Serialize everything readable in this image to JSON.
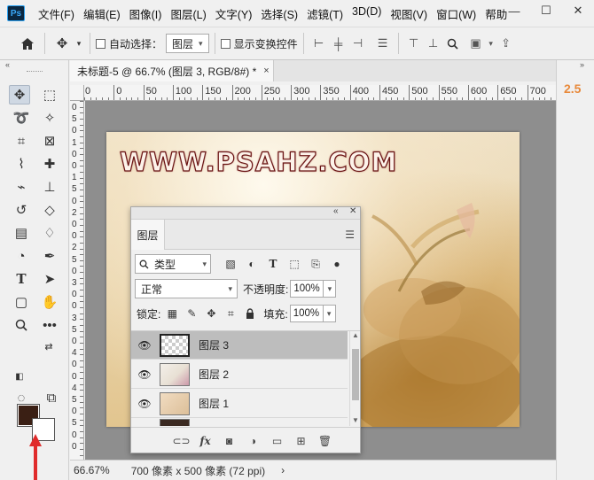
{
  "app": {
    "logo_text": "Ps"
  },
  "menu": [
    "文件(F)",
    "编辑(E)",
    "图像(I)",
    "图层(L)",
    "文字(Y)",
    "选择(S)",
    "滤镜(T)",
    "3D(D)",
    "视图(V)",
    "窗口(W)",
    "帮助"
  ],
  "window_controls": {
    "minimize": "—",
    "restore": "☐",
    "close": "✕"
  },
  "options": {
    "auto_select_label": "自动选择：",
    "auto_select_target": "图层",
    "show_transform_label": "显示变换控件"
  },
  "document": {
    "tab_title": "未标题-5 @ 66.7% (图层 3, RGB/8#) *",
    "close_glyph": "×",
    "ruler_h_labels": [
      "0",
      "0",
      "50",
      "100",
      "150",
      "200",
      "250",
      "300",
      "350",
      "400",
      "450",
      "500",
      "550",
      "600",
      "650",
      "700"
    ],
    "ruler_v_labels": [
      "0",
      "5",
      "0",
      "1",
      "0",
      "0",
      "1",
      "5",
      "0",
      "2",
      "0",
      "0",
      "2",
      "5",
      "0",
      "3",
      "0",
      "0",
      "3",
      "5",
      "0",
      "4",
      "0",
      "0",
      "4",
      "5",
      "0",
      "5",
      "0",
      "0"
    ]
  },
  "canvas": {
    "watermark": "WWW.PSAHZ.COM"
  },
  "dock": {
    "value": "2.5"
  },
  "status": {
    "zoom": "66.67%",
    "doc_info": "700 像素 x 500 像素 (72 ppi)",
    "arrow": "›"
  },
  "layers_panel": {
    "tab_label": "图层",
    "filter_kind": "类型",
    "blend_mode": "正常",
    "opacity_label": "不透明度:",
    "opacity_value": "100%",
    "lock_label": "锁定:",
    "fill_label": "填充:",
    "fill_value": "100%",
    "layers": [
      {
        "name": "图层 3",
        "selected": true,
        "thumb": "transparent"
      },
      {
        "name": "图层 2",
        "selected": false,
        "thumb": "art"
      },
      {
        "name": "图层 1",
        "selected": false,
        "thumb": "paper"
      }
    ]
  },
  "colors": {
    "foreground": "#3a1f14",
    "background": "#ffffff",
    "accent": "#e8893a"
  }
}
